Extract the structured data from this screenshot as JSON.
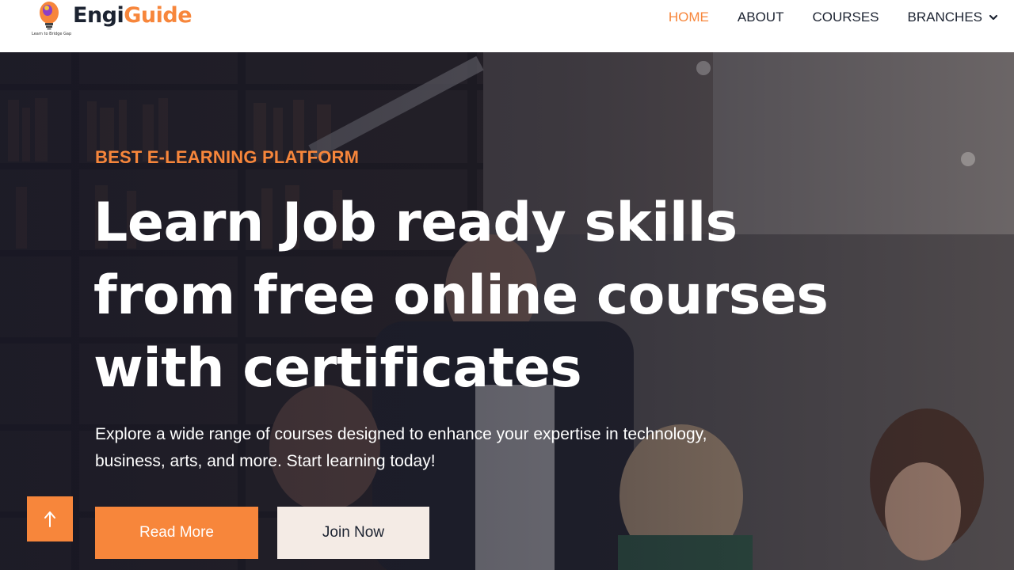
{
  "brand": {
    "name_part1": "Engi",
    "name_part2": "Guide",
    "tagline": "Learn to Bridge Gap",
    "icon": "lightbulb-logo-icon",
    "colors": {
      "accent": "#f7863b",
      "dark": "#1c2331"
    }
  },
  "nav": {
    "items": [
      {
        "label": "HOME",
        "active": true
      },
      {
        "label": "ABOUT",
        "active": false
      },
      {
        "label": "COURSES",
        "active": false
      },
      {
        "label": "BRANCHES",
        "active": false,
        "dropdown_icon": "chevron-down-icon"
      }
    ]
  },
  "hero": {
    "eyebrow": "BEST E-LEARNING PLATFORM",
    "headline_lines": [
      "Learn Job ready skills",
      "from free online courses",
      "with certificates"
    ],
    "lead_lines": [
      "Explore a wide range of courses designed to enhance your expertise in technology,",
      "business, arts, and more. Start learning today!"
    ],
    "primary_button": "Read More",
    "secondary_button": "Join Now"
  },
  "back_to_top": {
    "icon": "arrow-up-icon"
  }
}
